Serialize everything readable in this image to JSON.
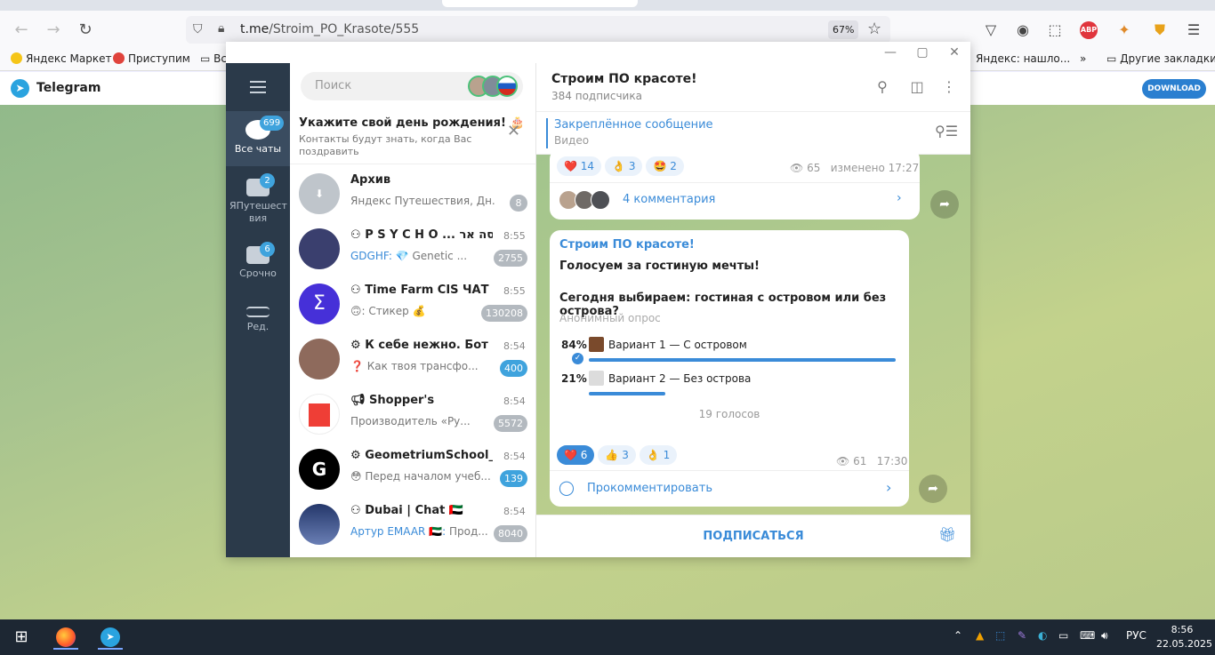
{
  "browser": {
    "url_host": "t.me",
    "url_path": "/Stroim_PO_Krasote/555",
    "zoom": "67%",
    "bookmarks": [
      {
        "label": "Яндекс Маркет"
      },
      {
        "label": "Приступим"
      },
      {
        "label": "Вс"
      },
      {
        "label": "Яндекс: нашло..."
      },
      {
        "label": "Другие закладки"
      }
    ]
  },
  "tgweb": {
    "brand": "Telegram",
    "download": "DOWNLOAD"
  },
  "sidebar": {
    "folders": [
      {
        "label": "Все чаты",
        "badge": "699"
      },
      {
        "label": "ЯПутешест вия",
        "badge": "2"
      },
      {
        "label": "Срочно",
        "badge": "6"
      },
      {
        "label": "Ред.",
        "badge": ""
      }
    ]
  },
  "chatlist": {
    "search_placeholder": "Поиск",
    "birthday_title": "Укажите свой день рождения! 🎂",
    "birthday_sub": "Контакты будут знать, когда Вас поздравить",
    "chats": [
      {
        "name": "Архив",
        "time": "",
        "who": "",
        "preview": "Яндекс Путешествия, Дн...",
        "badge": "8",
        "muted": true
      },
      {
        "name": "P S Y C H O ... פריסה אר",
        "time": "8:55",
        "who": "GDGHF:",
        "preview": " 💎 Genetic ...",
        "badge": "2755",
        "muted": true
      },
      {
        "name": "Time Farm CIS ЧАТ",
        "time": "8:55",
        "who": "",
        "preview": "🙃: Стикер 💰",
        "badge": "130208",
        "muted": true
      },
      {
        "name": "К себе нежно. Бот по...",
        "time": "8:54",
        "who": "",
        "preview": "❓ Как твоя трансфо...",
        "badge": "400",
        "muted": false
      },
      {
        "name": "Shopper's",
        "time": "8:54",
        "who": "",
        "preview": "Производитель «Ру...",
        "badge": "5572",
        "muted": true
      },
      {
        "name": "GeometriumSchool_Bot",
        "time": "8:54",
        "who": "",
        "preview": "😳 Перед началом учеб...",
        "badge": "139",
        "muted": false
      },
      {
        "name": "Dubai | Chat 🇦🇪",
        "time": "8:54",
        "who": "Артур EMAAR 🇦🇪:",
        "preview": " Прод...",
        "badge": "8040",
        "muted": true
      }
    ]
  },
  "chat": {
    "title": "Строим ПО красоте!",
    "subscribers": "384 подписчика",
    "pinned_title": "Закреплённое сообщение",
    "pinned_sub": "Видео",
    "prev_msg": {
      "reactions": [
        {
          "emoji": "❤️",
          "count": "14"
        },
        {
          "emoji": "👌",
          "count": "3"
        },
        {
          "emoji": "🤩",
          "count": "2"
        }
      ],
      "views": "65",
      "edited": "изменено 17:27",
      "comments": "4 комментария"
    },
    "poll": {
      "from": "Строим ПО красоте!",
      "line1": "Голосуем за гостиную мечты!",
      "line2": "Сегодня выбираем: гостиная с островом или без острова?",
      "type": "Анонимный опрос",
      "options": [
        {
          "pct": "84%",
          "label": "Вариант 1 — С островом",
          "share": 0.84,
          "swatch": "#7a4a2c",
          "chosen": true
        },
        {
          "pct": "21%",
          "label": "Вариант 2 — Без острова",
          "share": 0.21,
          "swatch": "#dcdcdc",
          "chosen": false
        }
      ],
      "votes": "19 голосов",
      "reactions": [
        {
          "emoji": "❤️",
          "count": "6"
        },
        {
          "emoji": "👍",
          "count": "3"
        },
        {
          "emoji": "👌",
          "count": "1"
        }
      ],
      "views": "61",
      "time": "17:30",
      "comment_cta": "Прокомментировать"
    },
    "subscribe": "ПОДПИСАТЬСЯ"
  },
  "taskbar": {
    "lang": "РУС",
    "time": "8:56",
    "date": "22.05.2025"
  }
}
